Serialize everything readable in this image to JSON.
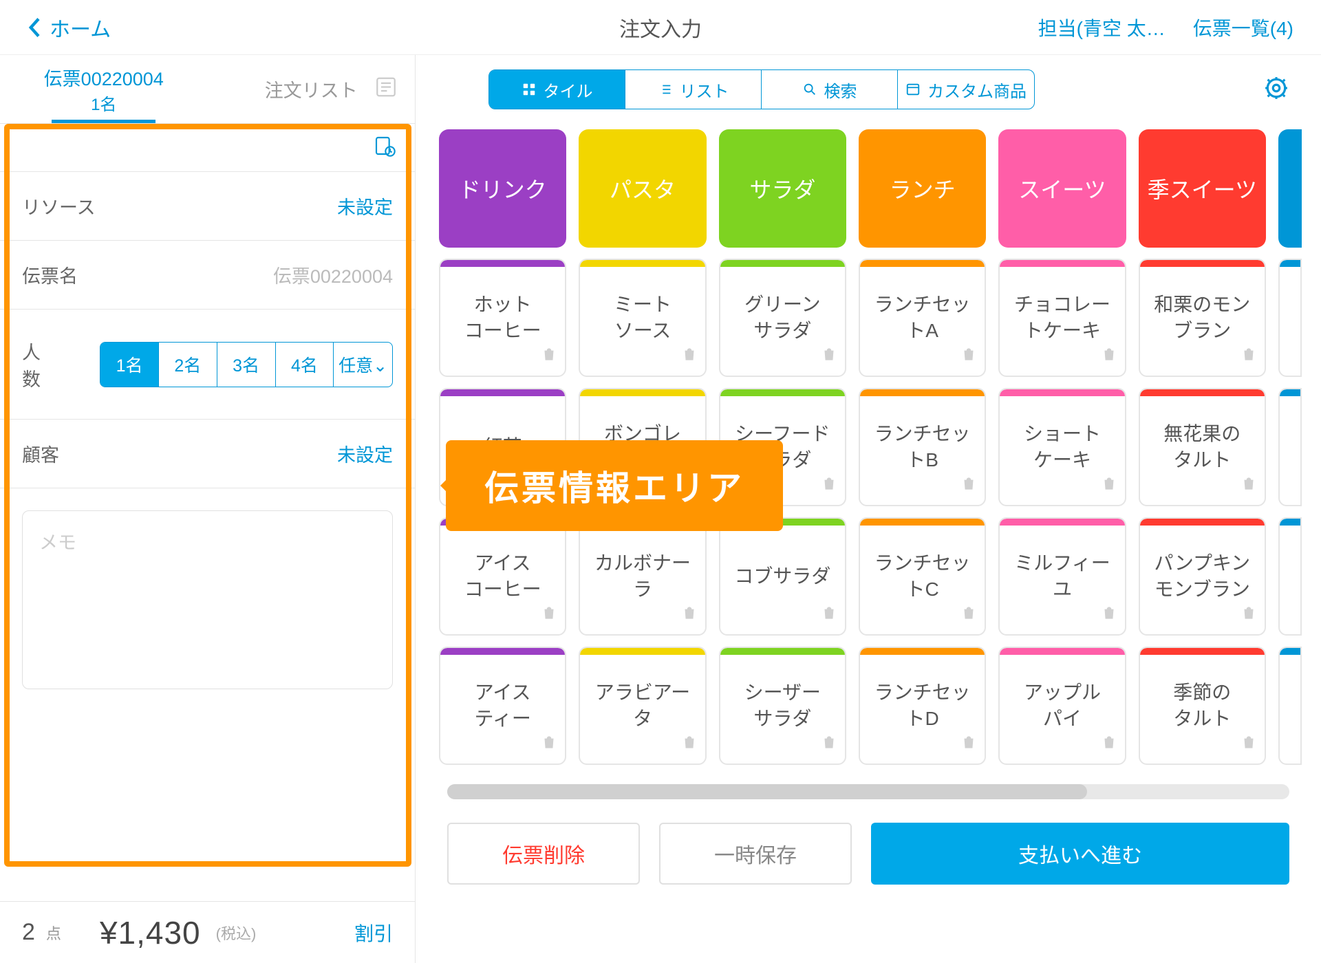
{
  "header": {
    "back": "ホーム",
    "title": "注文入力",
    "staff": "担当(青空 太…",
    "slips": "伝票一覧(4)"
  },
  "left": {
    "tab_slip": "伝票00220004",
    "tab_people": "1名",
    "tab_order": "注文リスト",
    "resource_lbl": "リソース",
    "resource_val": "未設定",
    "slipname_lbl": "伝票名",
    "slipname_val": "伝票00220004",
    "people_lbl": "人数",
    "people": [
      "1名",
      "2名",
      "3名",
      "4名",
      "任意⌄"
    ],
    "people_active": 0,
    "customer_lbl": "顧客",
    "customer_val": "未設定",
    "memo_placeholder": "メモ",
    "count": "2",
    "count_unit": "点",
    "price": "¥1,430",
    "tax": "(税込)",
    "discount": "割引"
  },
  "views": {
    "tile": "タイル",
    "list": "リスト",
    "search": "検索",
    "custom": "カスタム商品"
  },
  "cats": [
    {
      "name": "ドリンク",
      "cls": "c-purple"
    },
    {
      "name": "パスタ",
      "cls": "c-yellow"
    },
    {
      "name": "サラダ",
      "cls": "c-green"
    },
    {
      "name": "ランチ",
      "cls": "c-orange"
    },
    {
      "name": "スイーツ",
      "cls": "c-pink"
    },
    {
      "name": "季スイーツ",
      "cls": "c-red"
    }
  ],
  "products": [
    [
      {
        "n": "ホット\nコーヒー",
        "c": "t-purple"
      },
      {
        "n": "ミート\nソース",
        "c": "t-yellow"
      },
      {
        "n": "グリーン\nサラダ",
        "c": "t-green"
      },
      {
        "n": "ランチセッ\nトA",
        "c": "t-orange"
      },
      {
        "n": "チョコレー\nトケーキ",
        "c": "t-pink"
      },
      {
        "n": "和栗のモン\nブラン",
        "c": "t-red"
      }
    ],
    [
      {
        "n": "紅茶",
        "c": "t-purple"
      },
      {
        "n": "ボンゴレ\nビアンコ",
        "c": "t-yellow"
      },
      {
        "n": "シーフード\nサラダ",
        "c": "t-green"
      },
      {
        "n": "ランチセッ\nトB",
        "c": "t-orange"
      },
      {
        "n": "ショート\nケーキ",
        "c": "t-pink"
      },
      {
        "n": "無花果の\nタルト",
        "c": "t-red"
      }
    ],
    [
      {
        "n": "アイス\nコーヒー",
        "c": "t-purple"
      },
      {
        "n": "カルボナー\nラ",
        "c": "t-yellow"
      },
      {
        "n": "コブサラダ",
        "c": "t-green"
      },
      {
        "n": "ランチセッ\nトC",
        "c": "t-orange"
      },
      {
        "n": "ミルフィー\nユ",
        "c": "t-pink"
      },
      {
        "n": "パンプキン\nモンブラン",
        "c": "t-red"
      }
    ],
    [
      {
        "n": "アイス\nティー",
        "c": "t-purple"
      },
      {
        "n": "アラビアー\nタ",
        "c": "t-yellow"
      },
      {
        "n": "シーザー\nサラダ",
        "c": "t-green"
      },
      {
        "n": "ランチセッ\nトD",
        "c": "t-orange"
      },
      {
        "n": "アップル\nパイ",
        "c": "t-pink"
      },
      {
        "n": "季節の\nタルト",
        "c": "t-red"
      }
    ]
  ],
  "actions": {
    "delete": "伝票削除",
    "save": "一時保存",
    "pay": "支払いへ進む"
  },
  "callout": "伝票情報エリア"
}
